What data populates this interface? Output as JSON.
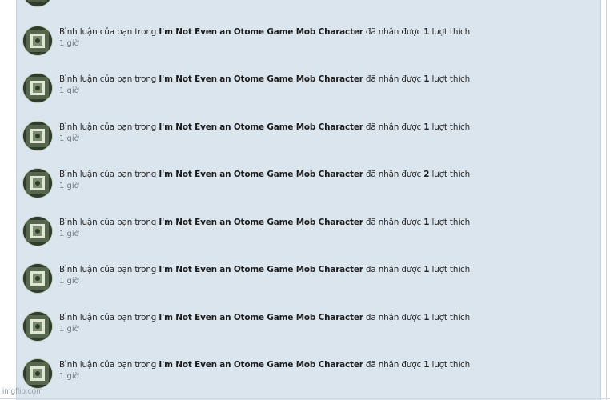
{
  "notifications": [
    {
      "prefix": "Bình luận của bạn trong",
      "title": "I'm Not Even an Otome Game Mob Character",
      "middle": "đã nhận được",
      "count": "1",
      "suffix": "lượt thích",
      "time": "1 giờ"
    },
    {
      "prefix": "Bình luận của bạn trong",
      "title": "I'm Not Even an Otome Game Mob Character",
      "middle": "đã nhận được",
      "count": "1",
      "suffix": "lượt thích",
      "time": "1 giờ"
    },
    {
      "prefix": "Bình luận của bạn trong",
      "title": "I'm Not Even an Otome Game Mob Character",
      "middle": "đã nhận được",
      "count": "1",
      "suffix": "lượt thích",
      "time": "1 giờ"
    },
    {
      "prefix": "Bình luận của bạn trong",
      "title": "I'm Not Even an Otome Game Mob Character",
      "middle": "đã nhận được",
      "count": "2",
      "suffix": "lượt thích",
      "time": "1 giờ"
    },
    {
      "prefix": "Bình luận của bạn trong",
      "title": "I'm Not Even an Otome Game Mob Character",
      "middle": "đã nhận được",
      "count": "1",
      "suffix": "lượt thích",
      "time": "1 giờ"
    },
    {
      "prefix": "Bình luận của bạn trong",
      "title": "I'm Not Even an Otome Game Mob Character",
      "middle": "đã nhận được",
      "count": "1",
      "suffix": "lượt thích",
      "time": "1 giờ"
    },
    {
      "prefix": "Bình luận của bạn trong",
      "title": "I'm Not Even an Otome Game Mob Character",
      "middle": "đã nhận được",
      "count": "1",
      "suffix": "lượt thích",
      "time": "1 giờ"
    },
    {
      "prefix": "Bình luận của bạn trong",
      "title": "I'm Not Even an Otome Game Mob Character",
      "middle": "đã nhận được",
      "count": "1",
      "suffix": "lượt thích",
      "time": "1 giờ"
    }
  ],
  "watermark": "imgflip.com"
}
